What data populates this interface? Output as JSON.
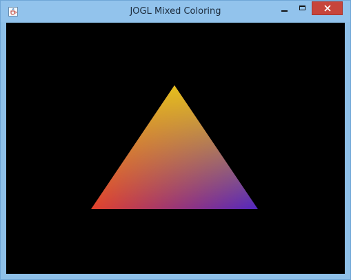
{
  "window": {
    "title": "JOGL Mixed Coloring",
    "icon": "java-cup-icon"
  },
  "controls": {
    "minimize_icon": "minimize-icon",
    "maximize_icon": "maximize-icon",
    "close_icon": "close-icon",
    "close_color": "#c7453b"
  },
  "canvas": {
    "background": "#000000",
    "shape": "triangle",
    "vertex_colors": {
      "top": "#e7c21a",
      "bottom_left": "#e4402a",
      "bottom_right": "#4d24c6"
    }
  }
}
